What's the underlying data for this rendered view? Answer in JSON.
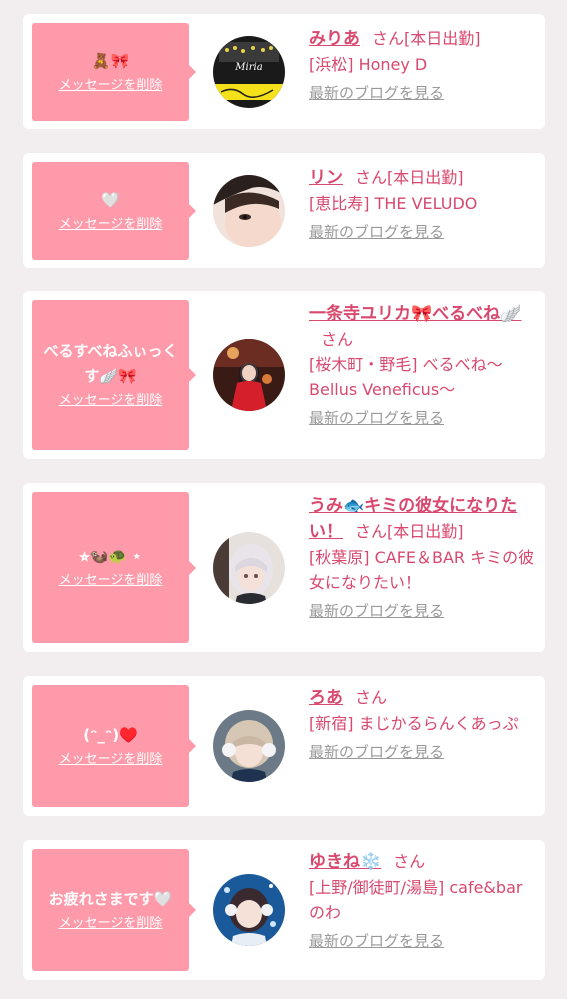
{
  "delete_label": "メッセージを削除",
  "blog_label": "最新のブログを見る",
  "honorific": "さん",
  "colors": {
    "background": "#f2edef",
    "card": "#ffffff",
    "bubble": "#ff9aaa",
    "accent": "#d9486e",
    "link_gray": "#999999"
  },
  "cards": [
    {
      "message": "🧸🎀",
      "name": "みりあ",
      "status": "[本日出勤]",
      "shop": "[浜松] Honey D",
      "avatar_text": "Miria"
    },
    {
      "message": "🤍",
      "name": "リン",
      "status": "[本日出勤]",
      "shop": "[恵比寿] THE VELUDO",
      "avatar_text": ""
    },
    {
      "message": "べるすべねふぃっくす🪽🎀",
      "name": "一条寺ユリカ🎀べるべね🪽",
      "status": "",
      "shop": "[桜木町・野毛] べるべね〜Bellus Veneficus〜",
      "avatar_text": ""
    },
    {
      "message": "⭐︎🦦🐢 ⋆",
      "name": "うみ🐟キミの彼女になりたい！",
      "status": "[本日出勤]",
      "shop": "[秋葉原] CAFE＆BAR キミの彼女になりたい！",
      "avatar_text": ""
    },
    {
      "message": "(ᵔ_ᵔ)♥️",
      "name": "ろあ",
      "status": "",
      "shop": "[新宿] まじかるらんくあっぷ",
      "avatar_text": ""
    },
    {
      "message": "お疲れさまです🤍",
      "name": "ゆきね❄️",
      "status": "",
      "shop": "[上野/御徒町/湯島] cafe&bar のわ",
      "avatar_text": ""
    }
  ]
}
